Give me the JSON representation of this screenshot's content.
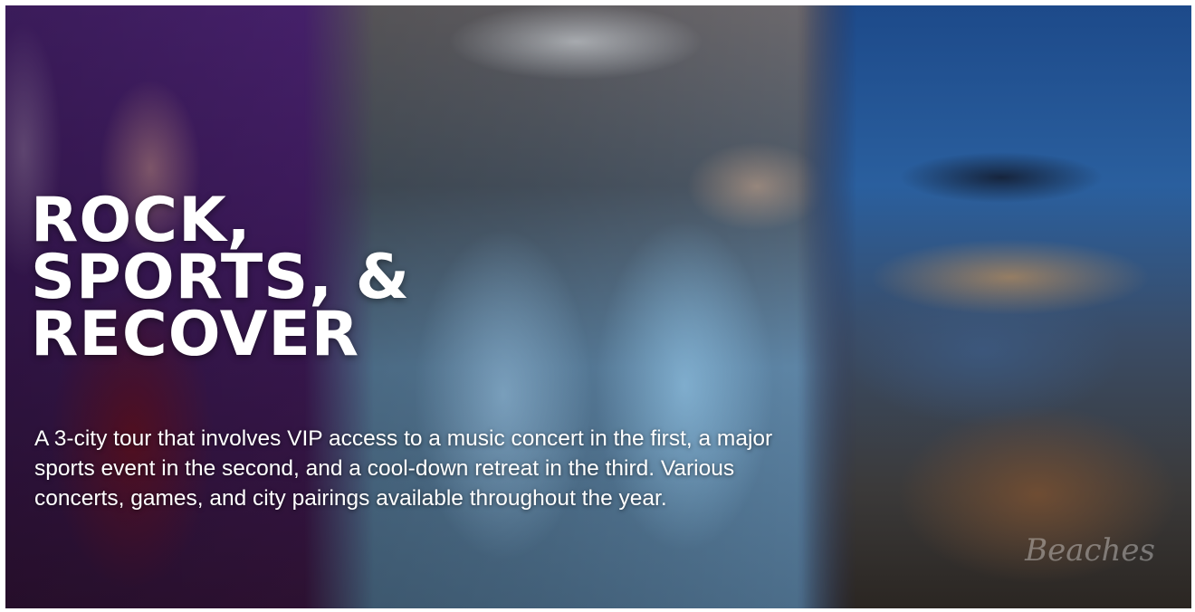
{
  "hero": {
    "headline": [
      "ROCK,",
      "SPORTS, &",
      "RECOVER"
    ],
    "description": "A 3-city tour that involves VIP access to a music concert in the first, a major sports event in the second, and a cool-down retreat in the third. Various concerts, games, and city pairings available throughout the year.",
    "watermark": "Beaches"
  },
  "images": {
    "concert": "concert-performer-photo",
    "sports": "football-team-celebration-photo",
    "resort": "resort-pool-night-photo"
  }
}
